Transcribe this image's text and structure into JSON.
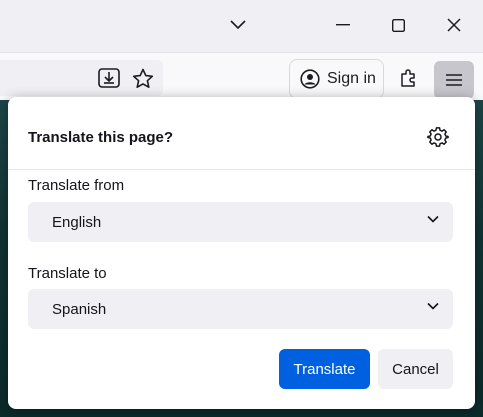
{
  "titlebar": {
    "list_all_tabs_icon": "chevron-down-icon",
    "minimize_icon": "minimize-icon",
    "maximize_icon": "maximize-icon",
    "close_icon": "close-icon"
  },
  "toolbar": {
    "download_icon": "download-icon",
    "bookmark_icon": "star-icon",
    "sign_in_label": "Sign in",
    "account_icon": "account-icon",
    "extensions_icon": "puzzle-icon",
    "menu_icon": "hamburger-menu-icon"
  },
  "translate_popup": {
    "title": "Translate this page?",
    "settings_icon": "gear-icon",
    "from_label": "Translate from",
    "from_value": "English",
    "to_label": "Translate to",
    "to_value": "Spanish",
    "translate_button": "Translate",
    "cancel_button": "Cancel"
  },
  "colors": {
    "accent": "#0061e0",
    "popup_bg": "#ffffff",
    "select_bg": "#f0f0f4",
    "page_bg": "#1d4647"
  }
}
